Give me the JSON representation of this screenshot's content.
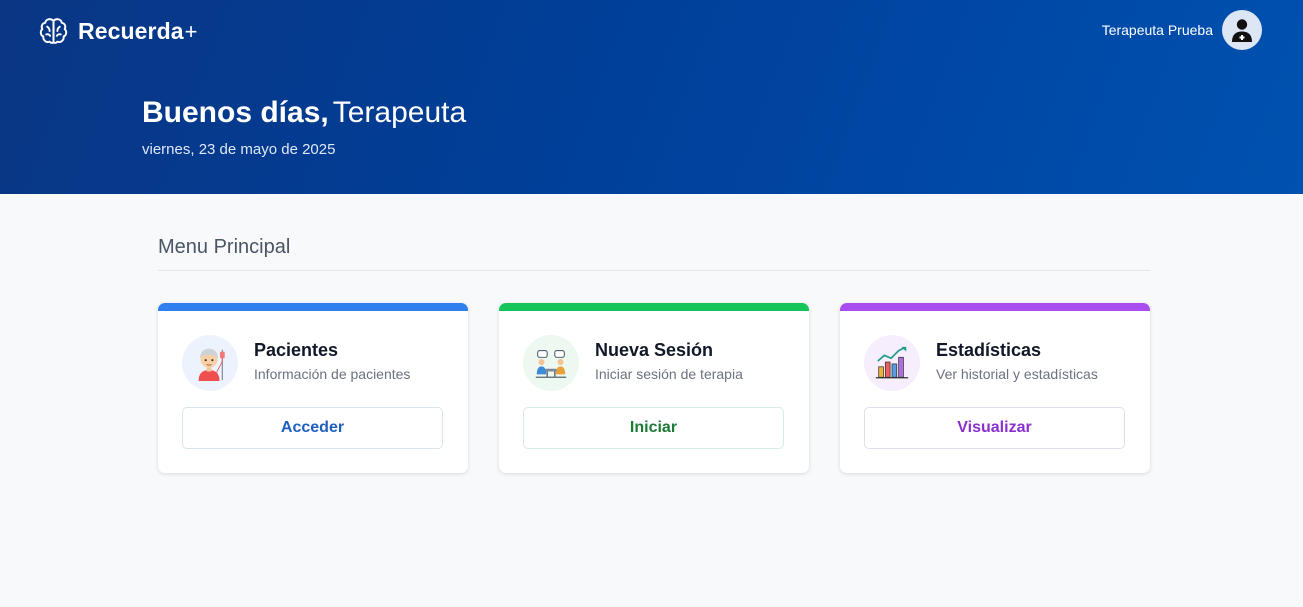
{
  "app": {
    "name": "Recuerda",
    "name_suffix": "+"
  },
  "user": {
    "name": "Terapeuta Prueba",
    "avatar_icon": "user-doctor-icon"
  },
  "greeting": {
    "salutation": "Buenos días,",
    "name": "Terapeuta",
    "date": "viernes, 23 de mayo de 2025"
  },
  "menu": {
    "title": "Menu Principal",
    "cards": [
      {
        "title": "Pacientes",
        "description": "Información de pacientes",
        "button": "Acceder",
        "icon": "patient-icon",
        "accent": "#2f7ff0",
        "button_color": "#1e5fbf",
        "icon_bg": "#edf3fd"
      },
      {
        "title": "Nueva Sesión",
        "description": "Iniciar sesión de terapia",
        "button": "Iniciar",
        "icon": "therapy-session-icon",
        "accent": "#15c45a",
        "button_color": "#1b7a35",
        "icon_bg": "#edf8f1"
      },
      {
        "title": "Estadísticas",
        "description": "Ver historial y estadísticas",
        "button": "Visualizar",
        "icon": "statistics-chart-icon",
        "accent": "#a84ef0",
        "button_color": "#8a2fd0",
        "icon_bg": "#f6eefc"
      }
    ]
  }
}
